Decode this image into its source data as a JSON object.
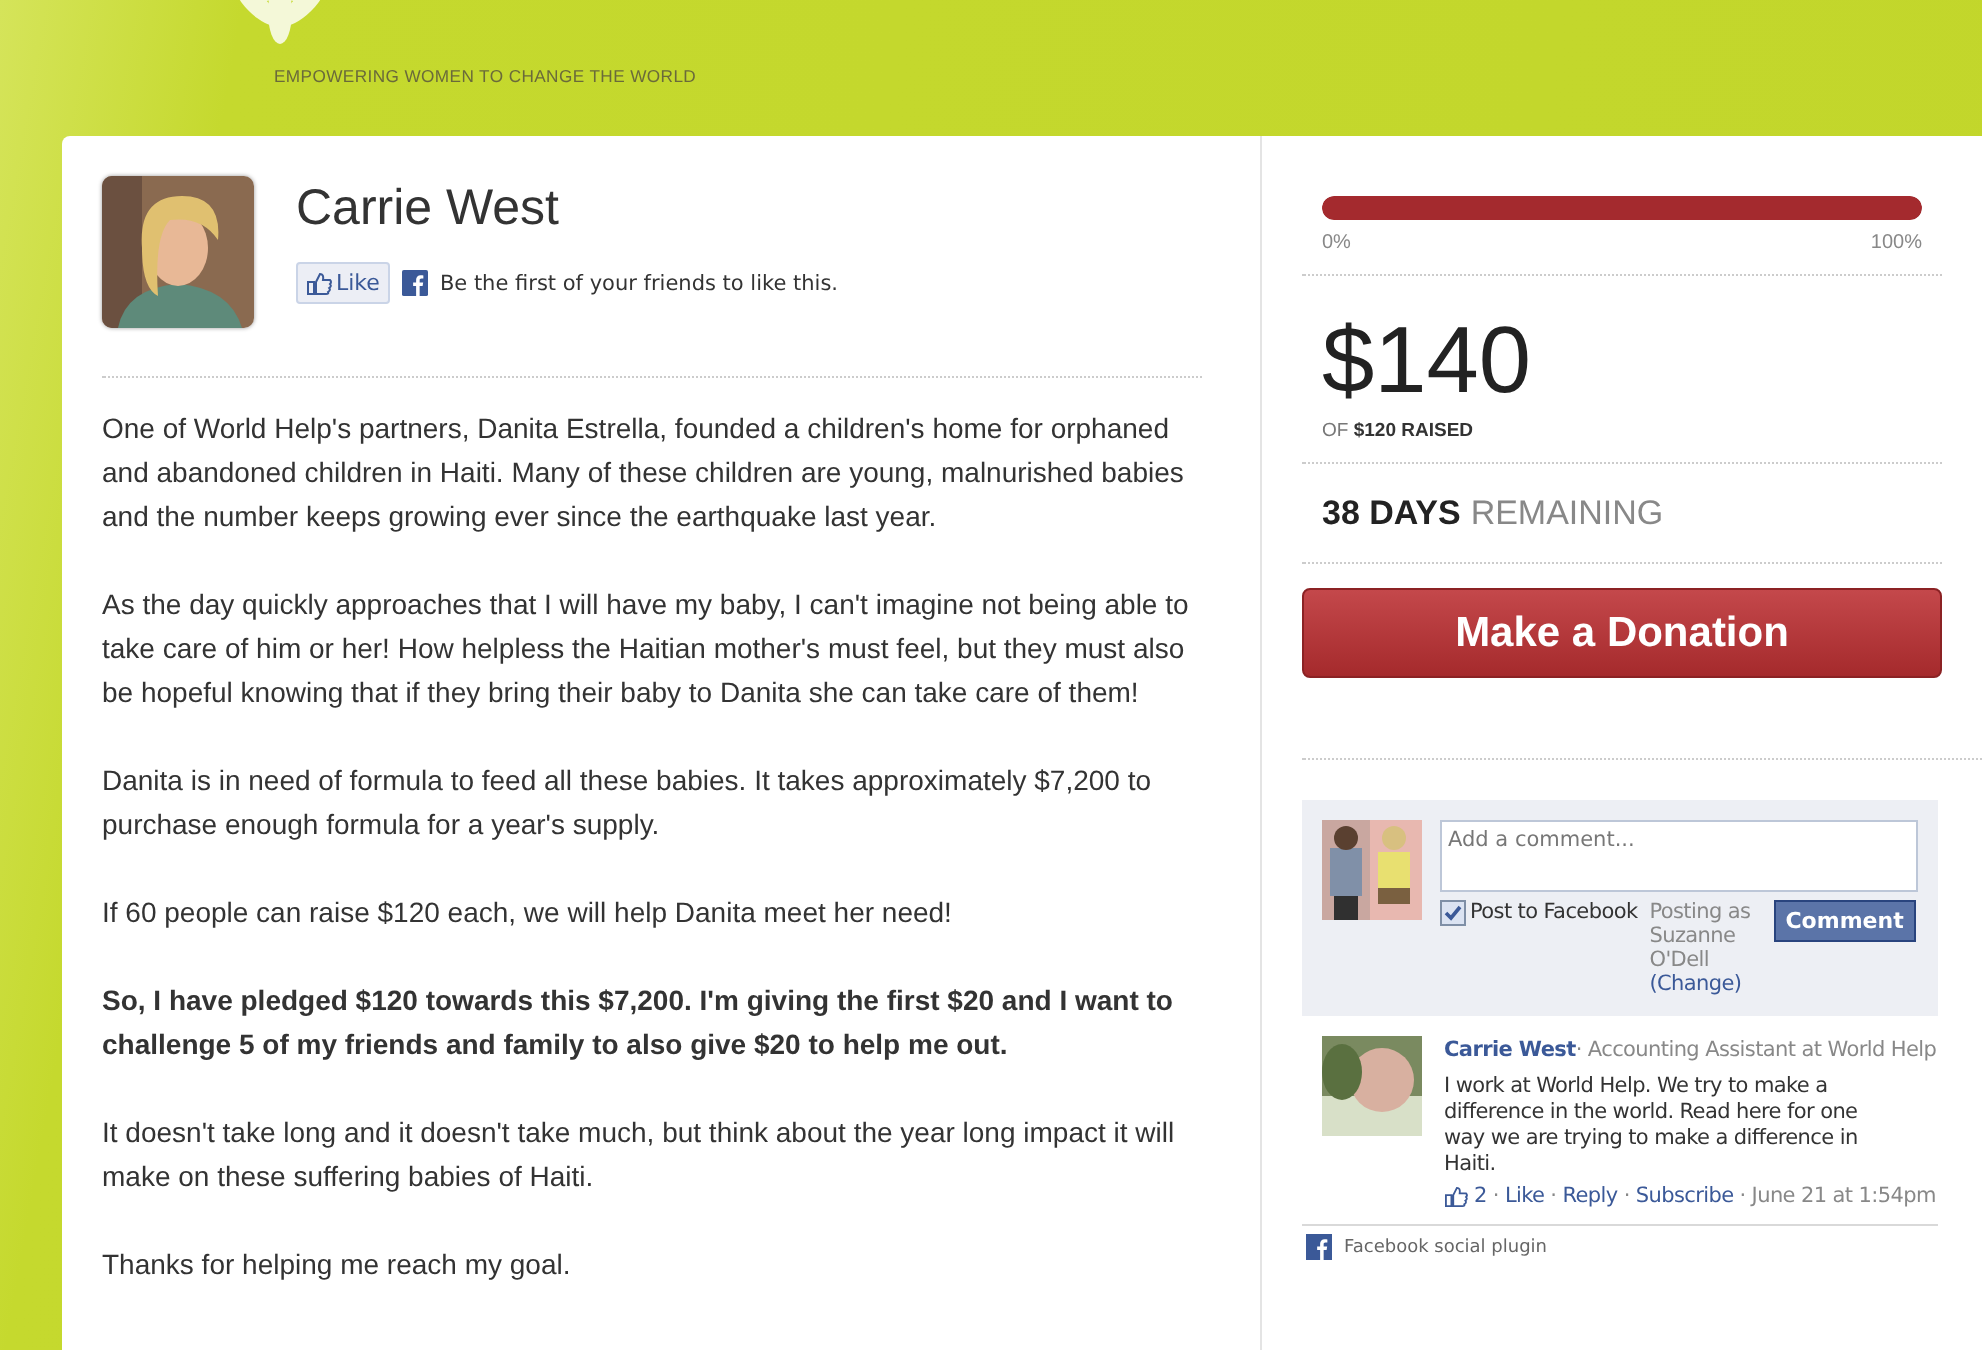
{
  "header": {
    "tagline": "EMPOWERING WOMEN TO CHANGE THE WORLD"
  },
  "profile": {
    "name": "Carrie West",
    "like_button": "Like",
    "like_text": "Be the first of your friends to like this."
  },
  "story": [
    {
      "text": "One of World Help's partners, Danita Estrella, founded a children's home for orphaned and abandoned children in Haiti. Many of these children are young, malnurished babies and the number keeps growing ever since the earthquake last year.",
      "bold": false
    },
    {
      "text": "As the day quickly approaches that I will have my baby, I can't imagine not being able to take care of him or her! How helpless the Haitian mother's must feel, but they must also be hopeful knowing that if they bring their baby to Danita she can take care of them!",
      "bold": false
    },
    {
      "text": "Danita is in need of formula to feed all these babies. It takes approximately $7,200 to purchase enough formula for a year's supply.",
      "bold": false
    },
    {
      "text": "If 60 people can raise $120 each, we will help Danita meet her need!",
      "bold": false
    },
    {
      "text": "So, I have pledged $120 towards this $7,200. I'm giving the first $20 and I want to challenge 5 of my friends and family to also give $20 to help me out.",
      "bold": true
    },
    {
      "text": "It doesn't take long and it doesn't take much, but think about the year long impact it will make on these suffering babies of Haiti.",
      "bold": false
    },
    {
      "text": "Thanks for helping me reach my goal.",
      "bold": false
    }
  ],
  "progress": {
    "level": 1,
    "min_label": "0%",
    "max_label": "100%"
  },
  "raised": {
    "amount": "$140",
    "goal": "OF **$120 RAISED**"
  },
  "remaining": {
    "days": "38 DAYS",
    "label": "REMAINING"
  },
  "donate_button": "Make a Donation",
  "comments": {
    "placeholder": "Add a comment...",
    "post_to_facebook": {
      "label": "Post to Facebook",
      "checked": true
    },
    "posting_as": "Posting as Suzanne O'Dell",
    "change_link": "(Change)",
    "comment_button": "Comment",
    "items": [
      {
        "author": "Carrie West",
        "subtitle": "Accounting Assistant at World Help",
        "text": "I work at World Help. We try to make a difference in the world. Read here for one way we are trying to make a difference in Haiti.",
        "likes": "2",
        "actions": [
          "Like",
          "Reply",
          "Subscribe"
        ],
        "separator": "·",
        "time": "June 21 at 1:54pm"
      }
    ],
    "plugin_label": "Facebook social plugin"
  }
}
